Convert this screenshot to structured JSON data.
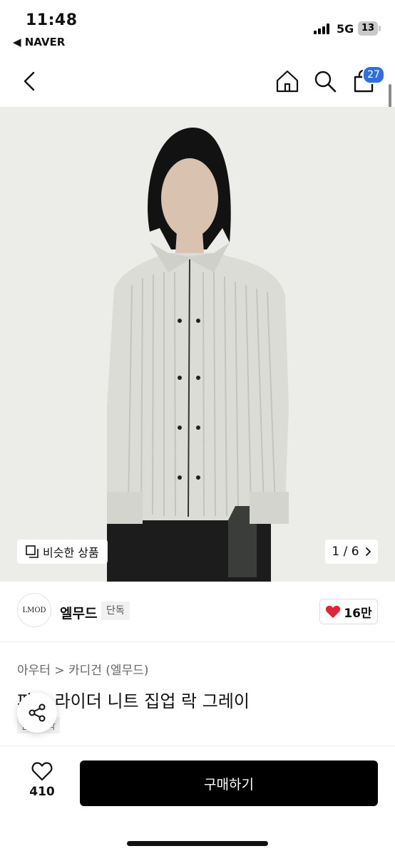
{
  "status": {
    "time": "11:48",
    "back_app": "◀ NAVER",
    "network": "5G",
    "battery": "13"
  },
  "nav": {
    "cart_count": "27"
  },
  "hero": {
    "similar_label": "비슷한 상품",
    "pager": "1 / 6"
  },
  "brand": {
    "logo_text": "LMOD",
    "name": "엘무드",
    "tag": "단독",
    "likes": "16만"
  },
  "product": {
    "breadcrumb": "아우터 > 카디건 (엘무드)",
    "title": "파... 라이더 니트 집업 락 그레이",
    "badge": "품절임박"
  },
  "bottom": {
    "wish_count": "410",
    "buy_label": "구매하기"
  },
  "colors": {
    "badge": "#2f6fe4",
    "heart": "#e52330",
    "buy": "#000000"
  }
}
